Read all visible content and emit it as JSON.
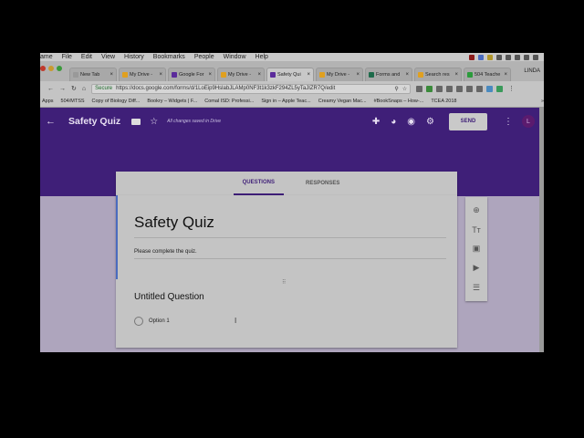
{
  "menubar": {
    "items": [
      "ame",
      "File",
      "Edit",
      "View",
      "History",
      "Bookmarks",
      "People",
      "Window",
      "Help"
    ]
  },
  "tabs": [
    {
      "label": "New Tab",
      "color": "#999"
    },
    {
      "label": "My Drive -",
      "color": "#e0a020"
    },
    {
      "label": "Google For",
      "color": "#5b2b9b"
    },
    {
      "label": "My Drive -",
      "color": "#e0a020"
    },
    {
      "label": "Safety Qui",
      "color": "#5b2b9b",
      "active": true
    },
    {
      "label": "My Drive -",
      "color": "#e0a020"
    },
    {
      "label": "Forms and",
      "color": "#1e6b4b"
    },
    {
      "label": "Search res",
      "color": "#e0a020"
    },
    {
      "label": "504 Teache",
      "color": "#2b9b3b"
    }
  ],
  "user": "LINDA",
  "address": {
    "secure": "Secure",
    "url": "https://docs.google.com/forms/d/1LoEip9HslabJLAMp0NF3t1k3zkF294ZL5yTaJIZR7Q/edit"
  },
  "bookmarks": [
    "Apps",
    "504/MTSS",
    "Copy of Biology Diff...",
    "Bookry – Widgets | F...",
    "Comal ISD: Professi...",
    "Sign in – Apple Teac...",
    "Creamy Vegan Mac...",
    "#BookSnaps – How-...",
    "TCEA 2018",
    "»"
  ],
  "header": {
    "title": "Safety Quiz",
    "saved": "All changes saved in Drive",
    "send": "SEND",
    "avatar": "L"
  },
  "card_tabs": {
    "questions": "QUESTIONS",
    "responses": "RESPONSES"
  },
  "form": {
    "title": "Safety Quiz",
    "description": "Please complete the quiz.",
    "question": "Untitled Question",
    "option": "Option 1"
  }
}
